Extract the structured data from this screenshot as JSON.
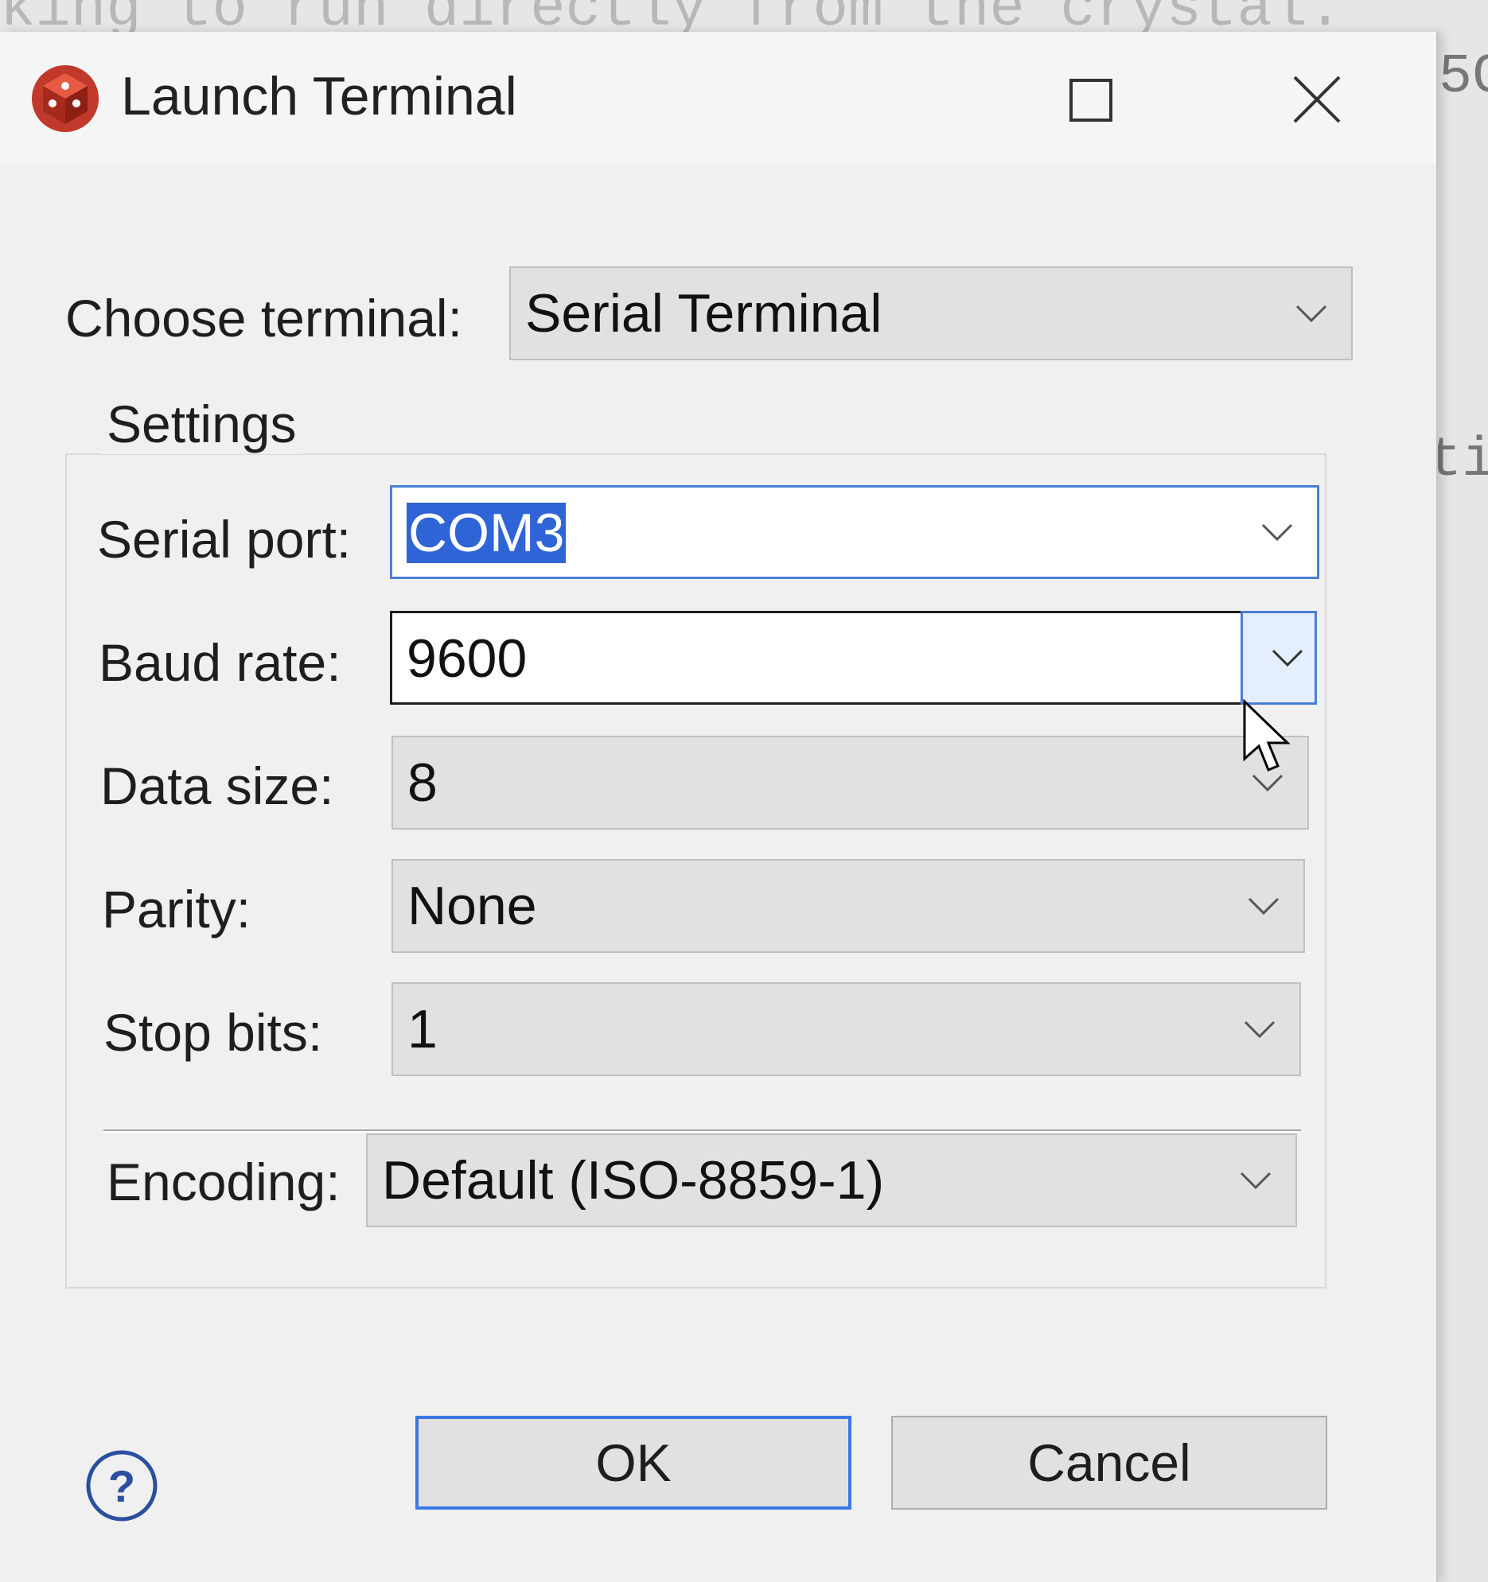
{
  "background": {
    "code_line": "king to run directly from the crystal.",
    "right_fragment_1": "5C",
    "right_fragment_2": "ti"
  },
  "window": {
    "title": "Launch Terminal"
  },
  "terminal_chooser": {
    "label": "Choose terminal:",
    "value": "Serial Terminal"
  },
  "settings": {
    "group_title": "Settings",
    "serial_port": {
      "label": "Serial port:",
      "value": "COM3"
    },
    "baud_rate": {
      "label": "Baud rate:",
      "value": "9600"
    },
    "data_size": {
      "label": "Data size:",
      "value": "8"
    },
    "parity": {
      "label": "Parity:",
      "value": "None"
    },
    "stop_bits": {
      "label": "Stop bits:",
      "value": "1"
    },
    "encoding": {
      "label": "Encoding:",
      "value": "Default (ISO-8859-1)"
    }
  },
  "buttons": {
    "ok": "OK",
    "cancel": "Cancel"
  },
  "colors": {
    "selection": "#2f64d6",
    "focus_border": "#4a7fd6",
    "app_icon": "#c0392b"
  }
}
